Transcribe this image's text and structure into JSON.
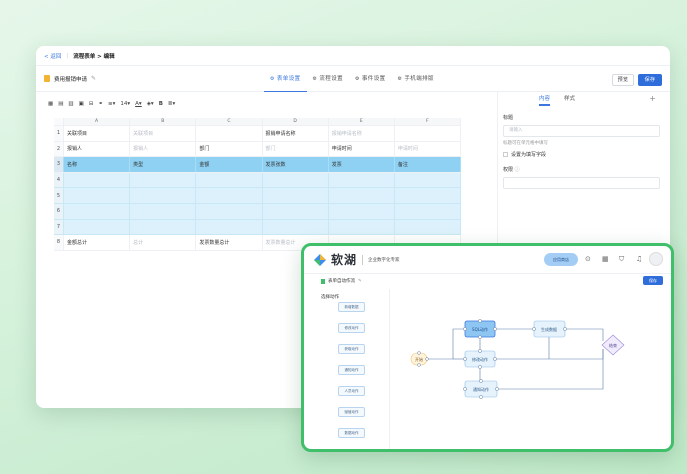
{
  "editor": {
    "breadcrumb": {
      "back": "返回",
      "path": "流程表单 > 编辑"
    },
    "form_title": "费用报销申请",
    "tabs": [
      {
        "label": "表单设置",
        "active": true
      },
      {
        "label": "流程设置",
        "active": false
      },
      {
        "label": "事件设置",
        "active": false
      },
      {
        "label": "手机端排版",
        "active": false
      }
    ],
    "preview_label": "预览",
    "save_label": "保存",
    "font_size": "14",
    "grid": {
      "columns": [
        "A",
        "B",
        "C",
        "D",
        "E",
        "F"
      ],
      "rows": [
        {
          "n": "1",
          "cells": [
            "关联项目",
            "关联项目",
            "",
            "报销申请名称",
            "报销申请名称",
            ""
          ]
        },
        {
          "n": "2",
          "cells": [
            "报销人",
            "报销人",
            "部门",
            "部门",
            "申请时间",
            "申请时间"
          ]
        },
        {
          "n": "3",
          "cells": [
            "名称",
            "类型",
            "金额",
            "发票张数",
            "发票",
            "备注"
          ]
        },
        {
          "n": "4",
          "cells": [
            "",
            "",
            "",
            "",
            "",
            ""
          ]
        },
        {
          "n": "5",
          "cells": [
            "",
            "",
            "",
            "",
            "",
            ""
          ]
        },
        {
          "n": "6",
          "cells": [
            "",
            "",
            "",
            "",
            "",
            ""
          ]
        },
        {
          "n": "7",
          "cells": [
            "",
            "",
            "",
            "",
            "",
            ""
          ]
        },
        {
          "n": "8",
          "cells": [
            "金额总计",
            "总计",
            "发票数量总计",
            "发票数量总计",
            "",
            ""
          ]
        }
      ]
    },
    "panel": {
      "tabs": [
        "内容",
        "样式"
      ],
      "title_label": "标题",
      "title_placeholder": "请输入",
      "hint": "标题可在单元格中填写",
      "checkbox_label": "设置为填写字段",
      "permission_label": "权限"
    }
  },
  "flow_app": {
    "logo": "软湖",
    "subtitle": "企业数字化专家",
    "pill": "应用商店",
    "page_title": "表单自动作流",
    "save_label": "保存",
    "sidebar_title": "选择动作",
    "actions": [
      "新增数据",
      "修改动作",
      "获取动作",
      "通知动作",
      "人员动作",
      "赋值动作",
      "数据动作"
    ],
    "nodes": {
      "start": "开始",
      "sql": "SQL动作",
      "generate": "生成数据",
      "modify": "修改动作",
      "notify": "通知动作",
      "end": "结束"
    }
  }
}
